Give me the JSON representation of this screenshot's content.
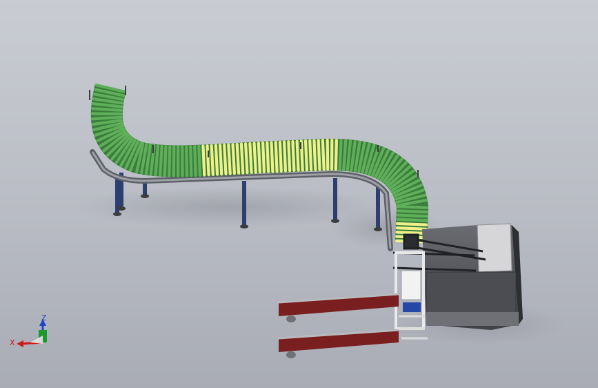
{
  "scene": {
    "subject": "roller-conveyor-line-with-palletizer",
    "colors": {
      "background_top": "#c9ccd3",
      "background_bottom": "#a9acb5",
      "roller_green": "#5fae5a",
      "roller_green_dark": "#2f6d34",
      "roller_yellow": "#eef08a",
      "frame_gray": "#8c8f96",
      "leg_blue": "#2c3f6e",
      "chain_red": "#7a1f1f",
      "machine_dark": "#55575c",
      "machine_light": "#d9d9dc"
    }
  },
  "triad": {
    "x_label": "X",
    "y_label": "",
    "z_label": "Z",
    "x_color": "#d01919",
    "y_color": "#1a9a2a",
    "z_color": "#2146c9"
  }
}
